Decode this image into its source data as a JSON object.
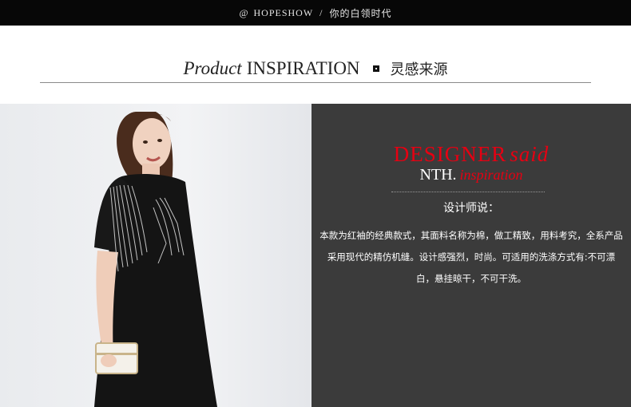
{
  "topbar": {
    "at_symbol": "@",
    "brand": "HOPESHOW",
    "separator": "/",
    "slogan": "你的白领时代"
  },
  "section_header": {
    "title_italic": "Product",
    "title_main": "INSPIRATION",
    "title_cn": "灵感来源"
  },
  "designer_panel": {
    "headline_red": "DESIGNER",
    "headline_italic": "said",
    "sub_white": "NTH.",
    "sub_italic": "inspiration",
    "label_cn": "设计师说：",
    "description_lines": [
      "本款为红袖的经典款式，其面料名称为棉，做工精致，用料考究，全系产品",
      "采用现代的精仿机缝。设计感强烈，时尚。可适用的洗涤方式有:不可漂",
      "白，悬挂晾干，不可干洗。"
    ]
  },
  "colors": {
    "topbar_bg": "#070707",
    "panel_bg": "#3b3b3b",
    "accent_red": "#e60012"
  },
  "photo": {
    "subject": "model-in-black-embroidered-dress"
  }
}
